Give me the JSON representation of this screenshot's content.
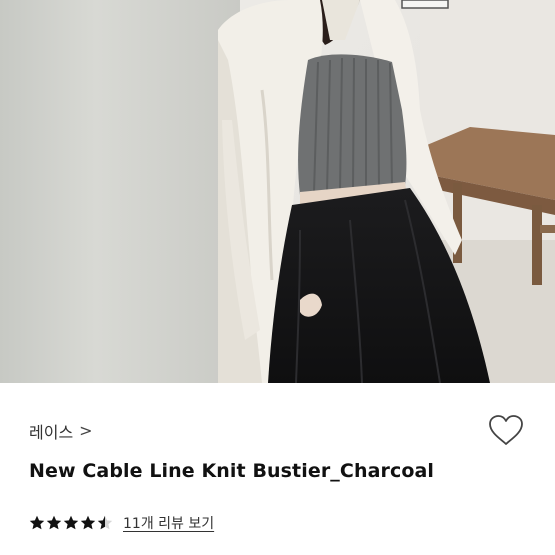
{
  "photo": {
    "alt": "",
    "icon": "product-photo"
  },
  "product": {
    "brand_label": "레이스",
    "brand_chevron": ">",
    "title": "New Cable Line Knit Bustier_Charcoal",
    "wish_icon": "heart-outline-icon"
  },
  "rating": {
    "value": 4.5,
    "max": 5,
    "review_link": "11개 리뷰 보기",
    "star_color": "#111111"
  }
}
